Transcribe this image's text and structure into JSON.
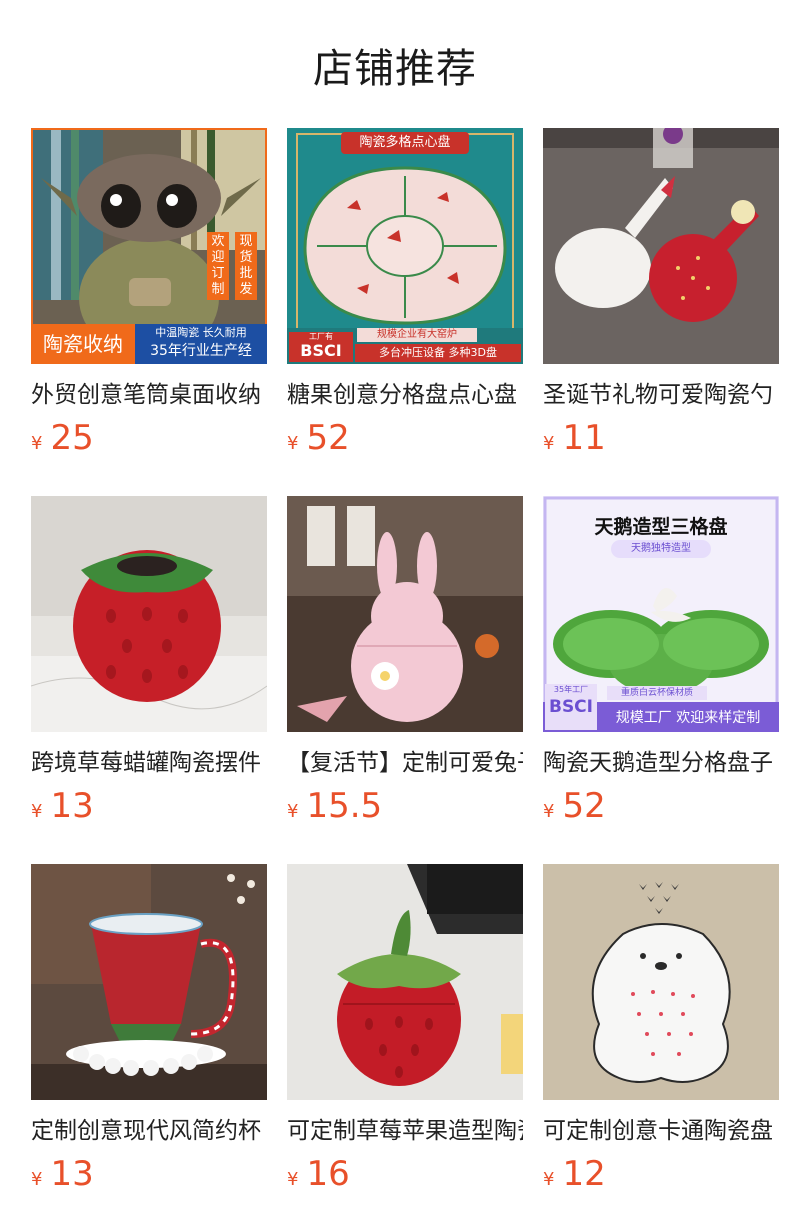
{
  "header": {
    "title": "店铺推荐"
  },
  "currency": "¥",
  "products": [
    {
      "name": "外贸创意笔筒桌面收纳",
      "price": "25",
      "badge_main": "陶瓷收纳",
      "badge_sub1": "中温陶瓷 长久耐用",
      "badge_sub2": "35年行业生产经",
      "tag1": "欢迎订制",
      "tag2": "现货批发"
    },
    {
      "name": "糖果创意分格盘点心盘",
      "price": "52",
      "banner": "陶瓷多格点心盘",
      "bottom1": "规模企业有大窑炉",
      "bottom2": "多台冲压设备 多种3D盘",
      "bsci": "BSCI",
      "factory": "工厂有"
    },
    {
      "name": "圣诞节礼物可爱陶瓷勺",
      "price": "11"
    },
    {
      "name": "跨境草莓蜡罐陶瓷摆件",
      "price": "13"
    },
    {
      "name": "【复活节】定制可爱兔子",
      "price": "15.5"
    },
    {
      "name": "陶瓷天鹅造型分格盘子",
      "price": "52",
      "heading": "天鹅造型三格盘",
      "subheading": "天鹅独特造型",
      "note": "重质白云杯保材质",
      "footer": "规模工厂 欢迎来样定制",
      "bsci": "BSCI",
      "years": "35年工厂"
    },
    {
      "name": "定制创意现代风简约杯",
      "price": "13"
    },
    {
      "name": "可定制草莓苹果造型陶瓷",
      "price": "16"
    },
    {
      "name": "可定制创意卡通陶瓷盘",
      "price": "12"
    }
  ]
}
